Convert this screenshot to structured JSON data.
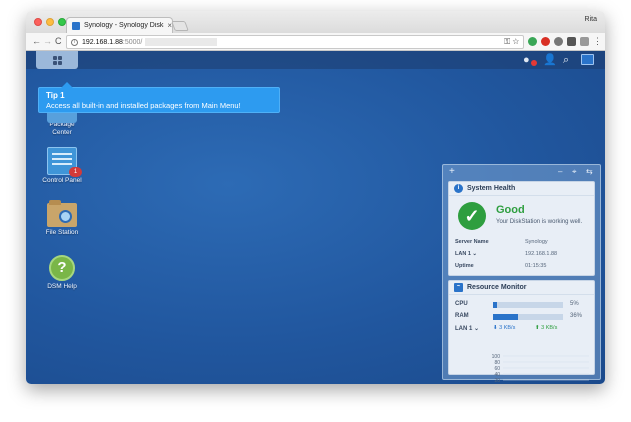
{
  "browser": {
    "tab_title": "Synology - Synology DiskStation",
    "tab_close": "×",
    "profile_name": "Rita",
    "url_host": "192.168.1.88",
    "url_port": ":5000/",
    "nav_back": "←",
    "nav_forward": "→",
    "nav_reload": "C",
    "omni_icons": "⚿ ☆",
    "menu": "⋮"
  },
  "dsm": {
    "tip": {
      "title": "Tip 1",
      "text": "Access all built-in and installed packages from Main Menu!"
    },
    "desktop_icons": [
      {
        "label": "Package Center",
        "label_line1": "Package",
        "label_line2": "Center"
      },
      {
        "label": "Control Panel",
        "badge": "1"
      },
      {
        "label": "File Station"
      },
      {
        "label": "DSM Help",
        "glyph": "?"
      }
    ],
    "panel_head": {
      "add": "+",
      "minimize": "–",
      "pin": "⌖",
      "settings": "⇆"
    },
    "system_health": {
      "title": "System Health",
      "icon": "i",
      "status": "Good",
      "message": "Your DiskStation is working well.",
      "rows": [
        {
          "key": "Server Name",
          "value": "Synology"
        },
        {
          "key": "LAN 1 ⌄",
          "value": "192.168.1.88"
        },
        {
          "key": "Uptime",
          "value": "01:15:35"
        }
      ]
    },
    "resource_monitor": {
      "title": "Resource Monitor",
      "cpu_label": "CPU",
      "cpu_percent": 5,
      "cpu_text": "5%",
      "ram_label": "RAM",
      "ram_percent": 36,
      "ram_text": "36%",
      "lan_label": "LAN 1 ⌄",
      "lan_down": "⬇ 3 KB/s",
      "lan_up": "⬆ 3 KB/s",
      "y_ticks": [
        "100",
        "80",
        "60",
        "40",
        "20",
        "0"
      ]
    },
    "colors": {
      "accent": "#2a73c9",
      "good": "#2e9e3f",
      "badge": "#d33a3a",
      "tip": "#2d9bf0"
    }
  }
}
